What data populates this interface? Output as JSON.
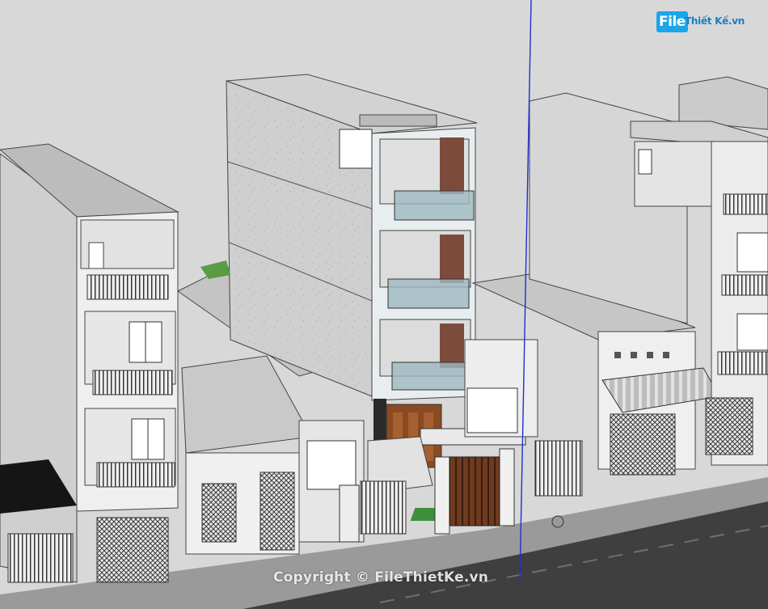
{
  "logo": {
    "file_label": "File",
    "site_label": "Thiết Kế.vn"
  },
  "watermark": {
    "text": "Copyright © FileThietKe.vn"
  },
  "colors": {
    "sky": "#d8d8d8",
    "wall_light": "#f2f2f2",
    "wall_mid": "#dcdcdc",
    "wall_shade": "#b9b9b9",
    "roof": "#c8c8c8",
    "road": "#3f3f3f",
    "sidewalk": "#9a9a9a",
    "glass": "#9db8c0",
    "wood_door": "#8a4a22",
    "brick_panel": "#7d4b3c",
    "axis_blue": "#1f2fd0",
    "logo_blue": "#1aa6e8"
  }
}
